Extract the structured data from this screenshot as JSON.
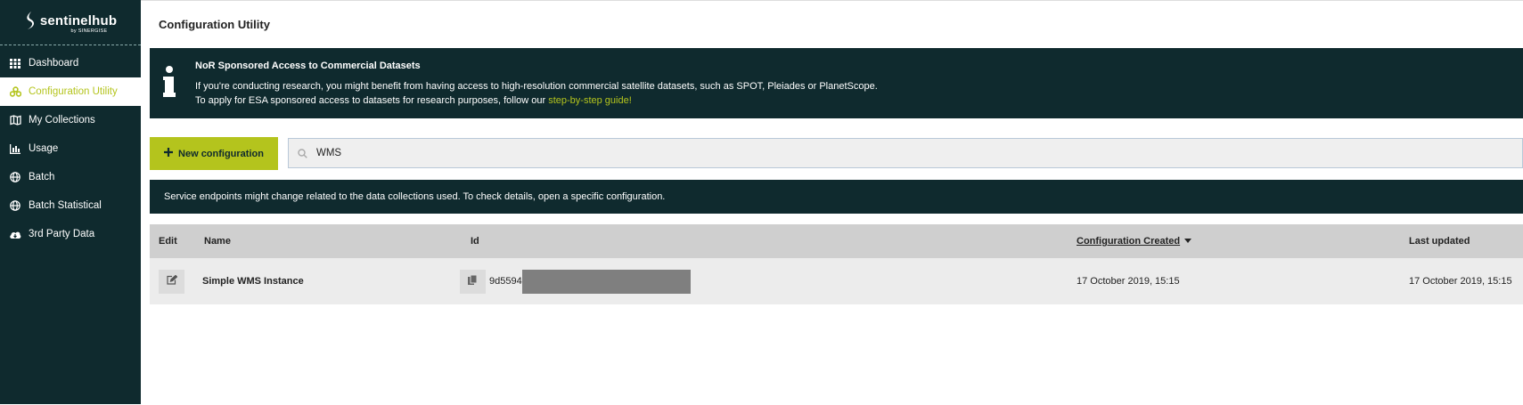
{
  "brand": {
    "name": "sentinelhub",
    "sub": "by SINERGISE"
  },
  "sidebar": {
    "items": [
      {
        "label": "Dashboard",
        "icon": "grid-icon"
      },
      {
        "label": "Configuration Utility",
        "icon": "config-icon"
      },
      {
        "label": "My Collections",
        "icon": "map-icon"
      },
      {
        "label": "Usage",
        "icon": "bar-chart-icon"
      },
      {
        "label": "Batch",
        "icon": "globe-icon"
      },
      {
        "label": "Batch Statistical",
        "icon": "globe-icon"
      },
      {
        "label": "3rd Party Data",
        "icon": "cloud-download-icon"
      }
    ],
    "active_index": 1
  },
  "page": {
    "title": "Configuration Utility"
  },
  "banner": {
    "title": "NoR Sponsored Access to Commercial Datasets",
    "line1": "If you're conducting research, you might benefit from having access to high-resolution commercial satellite datasets, such as SPOT, Pleiades or PlanetScope.",
    "line2_prefix": "To apply for ESA sponsored access to datasets for research purposes, follow our ",
    "line2_link": "step-by-step guide!"
  },
  "toolbar": {
    "new_label": "New configuration"
  },
  "search": {
    "value": "WMS"
  },
  "notice": "Service endpoints might change related to the data collections used. To check details, open a specific configuration.",
  "table": {
    "headers": {
      "edit": "Edit",
      "name": "Name",
      "id": "Id",
      "created": "Configuration Created",
      "updated": "Last updated"
    },
    "rows": [
      {
        "name": "Simple WMS Instance",
        "id_visible": "9d5594",
        "created": "17 October 2019, 15:15",
        "updated": "17 October 2019, 15:15"
      }
    ]
  },
  "colors": {
    "sidebar_bg": "#0f2a2e",
    "accent": "#b4c41d",
    "header_bg": "#cfcfcf",
    "row_bg": "#ececec"
  }
}
